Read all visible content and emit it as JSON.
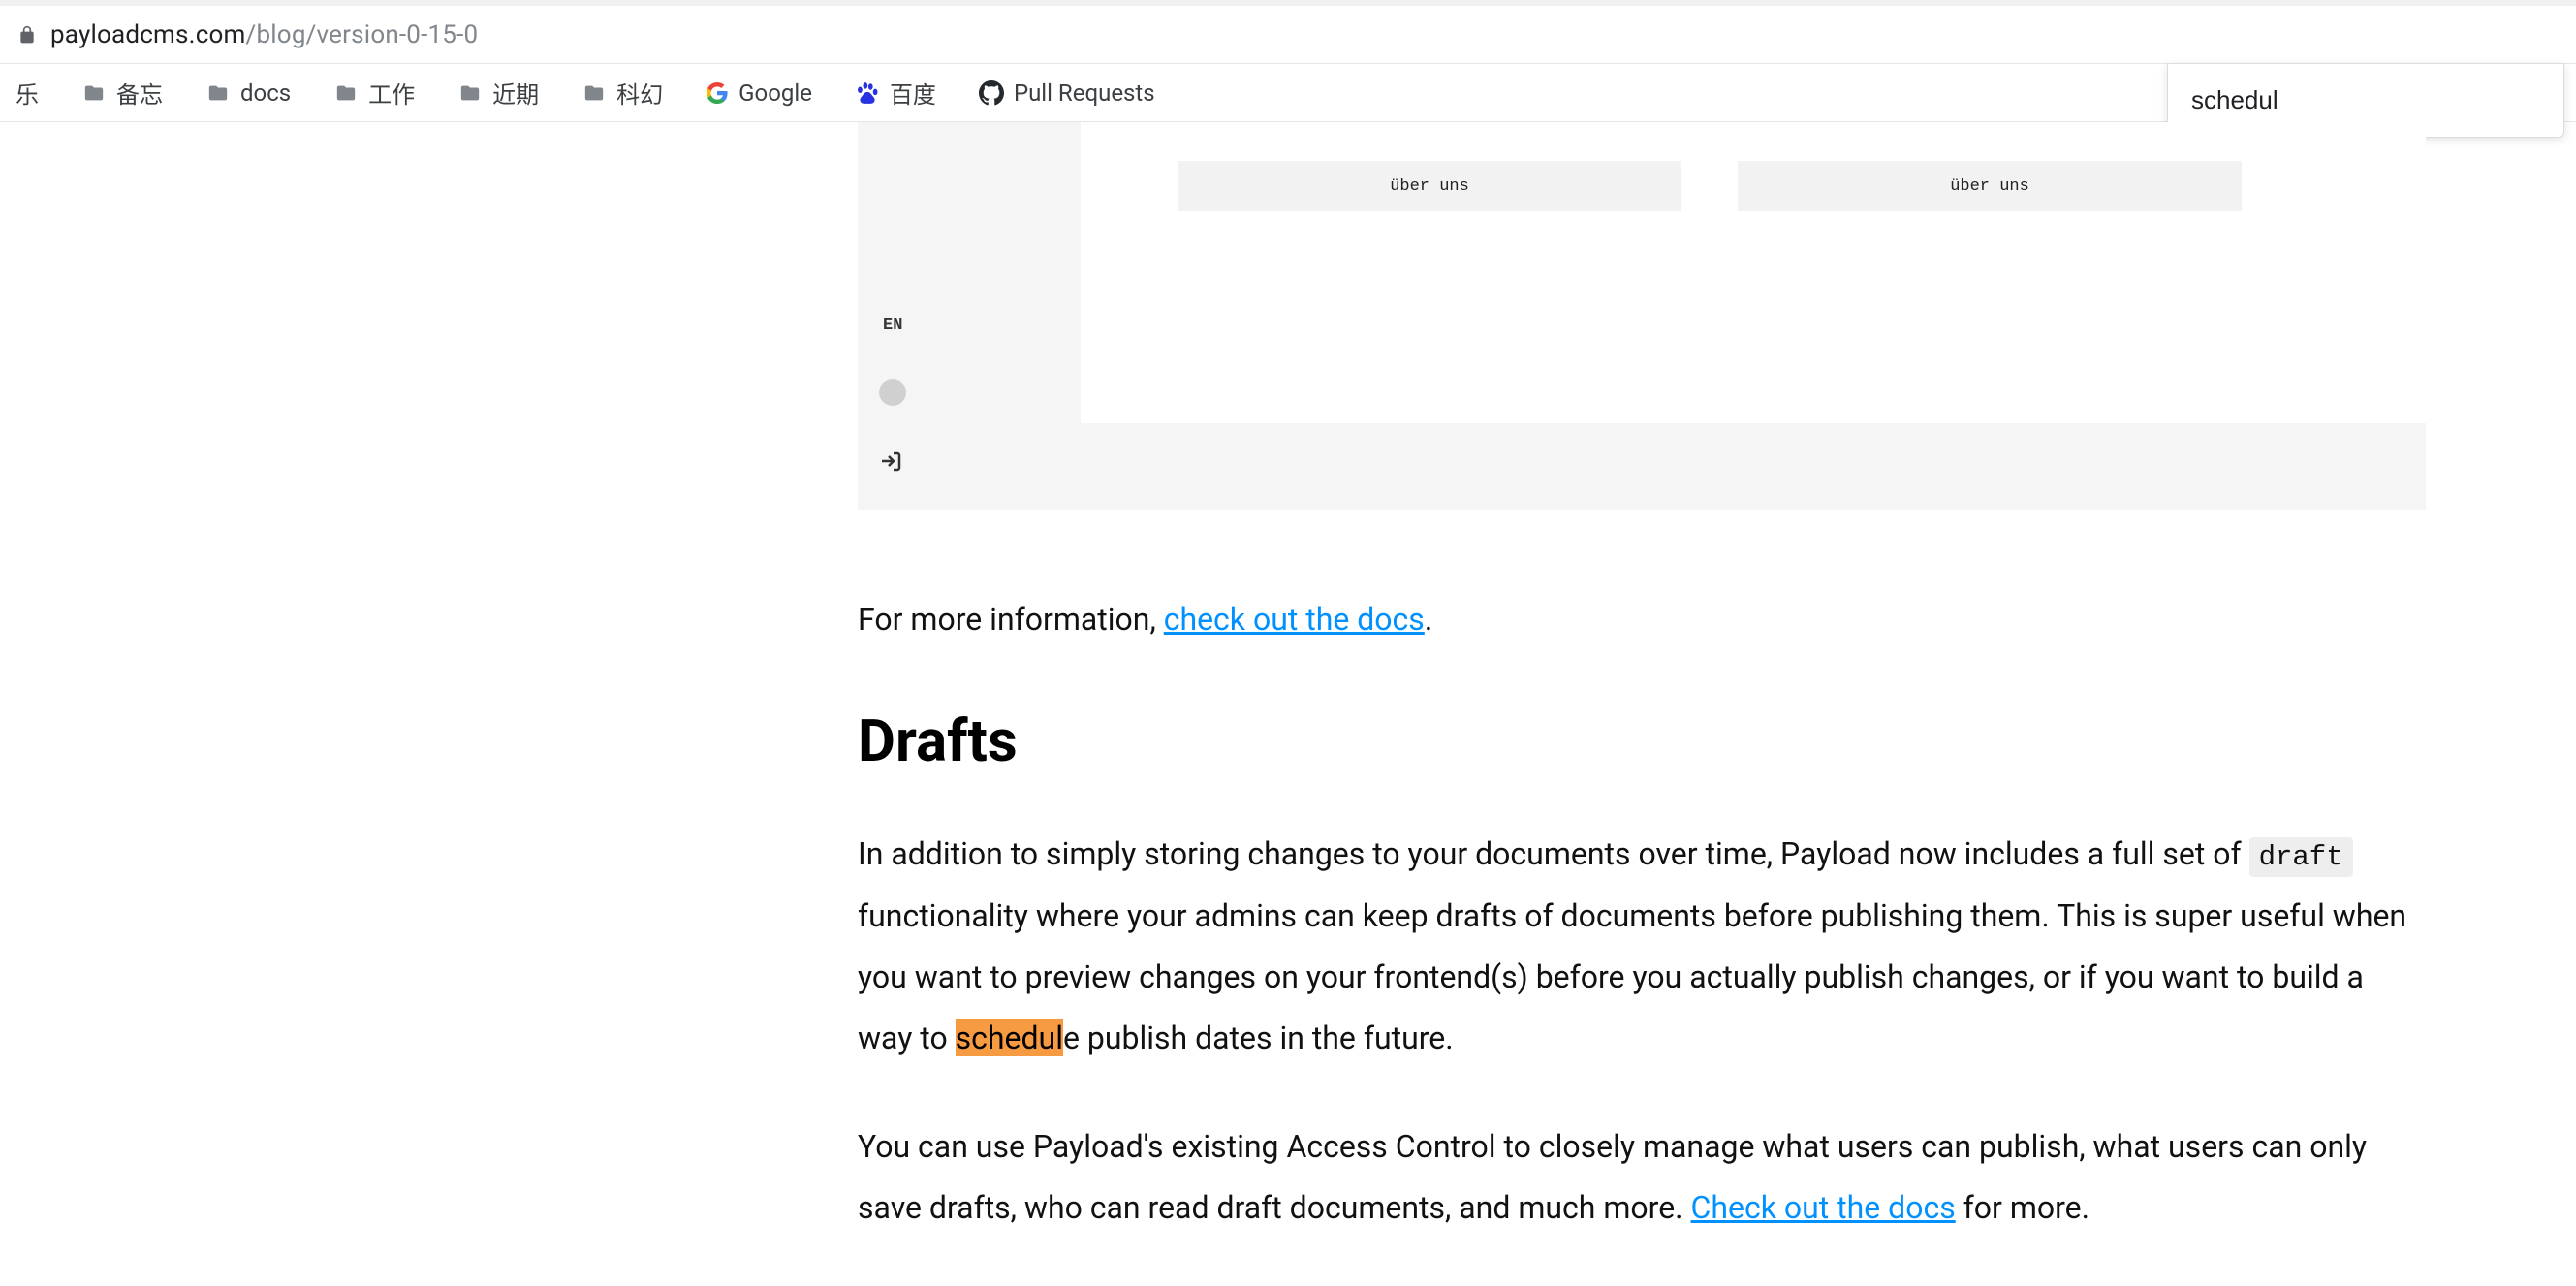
{
  "browser": {
    "url_host": "payloadcms.com",
    "url_path": "/blog/version-0-15-0",
    "find_value": "schedul"
  },
  "bookmarks": [
    {
      "label": "乐",
      "type": "folder-partial"
    },
    {
      "label": "备忘",
      "type": "folder"
    },
    {
      "label": "docs",
      "type": "folder"
    },
    {
      "label": "工作",
      "type": "folder"
    },
    {
      "label": "近期",
      "type": "folder"
    },
    {
      "label": "科幻",
      "type": "folder"
    },
    {
      "label": "Google",
      "type": "google"
    },
    {
      "label": "百度",
      "type": "baidu"
    },
    {
      "label": "Pull Requests",
      "type": "github"
    }
  ],
  "admin_embed": {
    "lang": "EN",
    "field1": "über uns",
    "field2": "über uns"
  },
  "article": {
    "p1_prefix": "For more information, ",
    "p1_link": "check out the docs",
    "p1_suffix": ".",
    "h2": "Drafts",
    "p2_part1": "In addition to simply storing changes to your documents over time, Payload now includes a full set of ",
    "p2_code": "draft",
    "p2_part2": " functionality where your admins can keep drafts of documents before publishing them. This is super useful when you want to preview changes on your frontend(s) before you actually publish changes, or if you want to build a way to ",
    "p2_highlight": "schedul",
    "p2_part3": "e publish dates in the future.",
    "p3_part1": "You can use Payload's existing Access Control to closely manage what users can publish, what users can only save drafts, who can read draft documents, and much more. ",
    "p3_link": "Check out the docs",
    "p3_part2": " for more."
  }
}
